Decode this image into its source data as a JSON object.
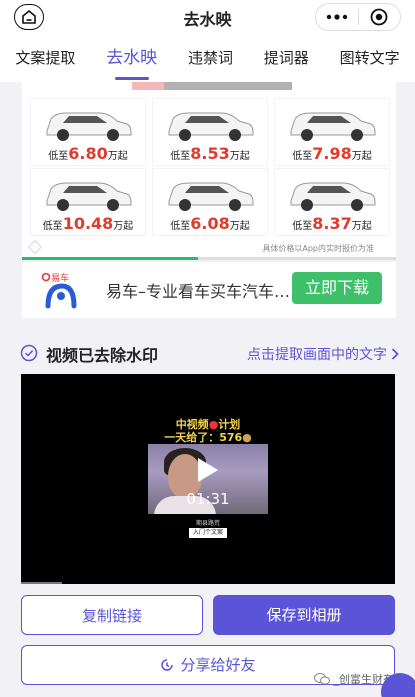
{
  "header": {
    "title": "去水映"
  },
  "tabs": [
    {
      "label": "文案提取"
    },
    {
      "label": "去水映"
    },
    {
      "label": "违禁词"
    },
    {
      "label": "提词器"
    },
    {
      "label": "图转文字"
    }
  ],
  "ad": {
    "prefix": "低至",
    "suffix": "万起",
    "prices": [
      "6.80",
      "8.53",
      "7.98",
      "10.48",
      "6.08",
      "8.37"
    ],
    "footnote": "具体价格以App内实时报价为准",
    "progress": 0.47
  },
  "banner": {
    "text": "易车–专业看车买车汽车…",
    "button": "立即下载",
    "logo_text": "易车"
  },
  "section": {
    "title": "视频已去除水印",
    "link": "点击提取画面中的文字"
  },
  "video": {
    "headline_line1": "中视频",
    "headline_line2": "计划",
    "headline_line3": "一天给了：576",
    "duration": "01:31",
    "sub": "期县路荒",
    "tag": "入门个文案",
    "progress": 0.11
  },
  "buttons": {
    "copy": "复制链接",
    "save": "保存到相册",
    "share": "分享给好友"
  },
  "watermark": "_创富生财有道",
  "colors": {
    "accent": "#5b54d6",
    "download_green": "#3ec06a",
    "price_red": "#e23b2e"
  }
}
